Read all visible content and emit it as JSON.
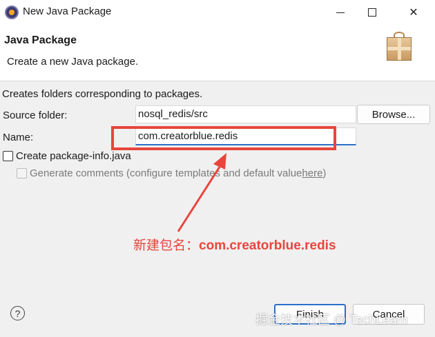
{
  "window": {
    "title": "New Java Package"
  },
  "header": {
    "title": "Java Package",
    "description": "Create a new Java package."
  },
  "form": {
    "info_text": "Creates folders corresponding to packages.",
    "source_folder_label": "Source folder:",
    "source_folder_value": "nosql_redis/src",
    "browse_label": "Browse...",
    "name_label": "Name:",
    "name_value": "com.creatorblue.redis",
    "create_info_label": "Create package-info.java",
    "create_info_checked": false,
    "generate_comments_prefix": "Generate comments (configure templates and default value ",
    "generate_comments_link": "here",
    "generate_comments_suffix": ")",
    "generate_comments_checked": false
  },
  "footer": {
    "help_glyph": "?",
    "finish_label": "Finish",
    "cancel_label": "Cancel"
  },
  "annotation": {
    "prefix": "新建包名：",
    "value": "com.creatorblue.redis",
    "color": "#e8453c"
  },
  "watermark": "掘金技术社区 @ TechLearn",
  "colors": {
    "accent": "#2a6fc9",
    "annotation_red": "#e8453c"
  },
  "icons": [
    "eclipse-app-icon",
    "minimize-icon",
    "maximize-icon",
    "close-icon",
    "package-wizard-icon",
    "help-icon"
  ]
}
